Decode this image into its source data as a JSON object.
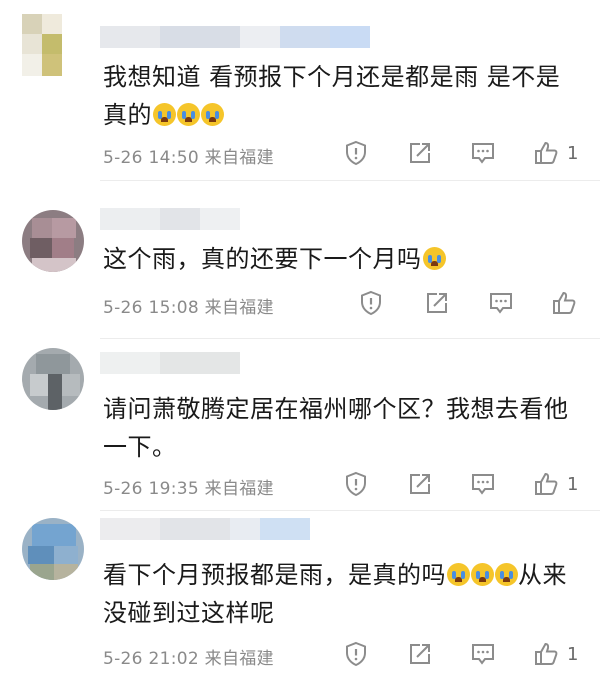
{
  "comments": [
    {
      "text_line1": "我想知道 看预报下个月还是都是雨  是不是",
      "text_line2": "真的",
      "emoji_count": 3,
      "meta": "5-26 14:50 来自福建",
      "likes": "1"
    },
    {
      "text_line1": "这个雨，真的还要下一个月吗",
      "emoji_count": 1,
      "meta": "5-26 15:08 来自福建",
      "likes": ""
    },
    {
      "text_line1": "请问萧敬腾定居在福州哪个区？我想去看他",
      "text_line2": "一下。",
      "emoji_count": 0,
      "meta": "5-26 19:35 来自福建",
      "likes": "1"
    },
    {
      "text_line1": "看下个月预报都是雨，是真的吗",
      "text_line1_tail": "从来",
      "text_line2": "没碰到过这样呢",
      "emoji_count": 3,
      "meta": "5-26 21:02 来自福建",
      "likes": "1"
    }
  ],
  "icons": {
    "report": "shield-exclamation-icon",
    "repost": "share-arrow-icon",
    "reply": "comment-bubble-icon",
    "like": "thumbs-up-icon"
  },
  "colors": {
    "text": "#1a1a1a",
    "meta": "#8a8a8a",
    "icon": "#8c8c8c",
    "emoji": "#f5c52a"
  }
}
